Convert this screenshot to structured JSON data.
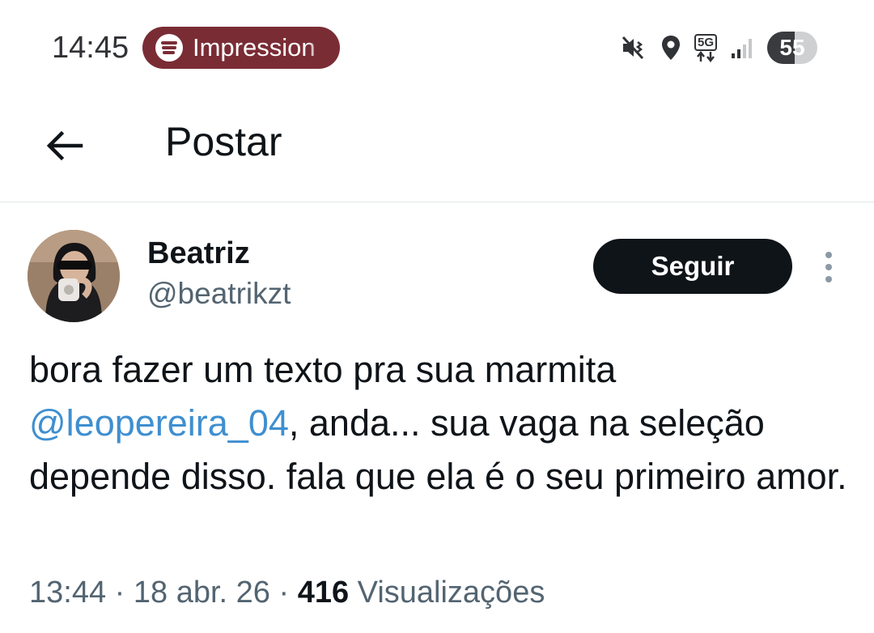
{
  "status_bar": {
    "time": "14:45",
    "media_pill": {
      "app_icon": "spotify-icon",
      "label": "Impression",
      "color": "#7a2c35"
    },
    "network_label": "5G",
    "battery_level": "55",
    "battery_fraction": 0.55,
    "icons": [
      "mute-vibrate-icon",
      "location-icon",
      "5g-data-icon",
      "signal-icon",
      "battery-icon"
    ]
  },
  "header": {
    "back_icon": "arrow-left-icon",
    "title": "Postar"
  },
  "post": {
    "author_name": "Beatriz",
    "author_handle": "@beatrikzt",
    "follow_label": "Seguir",
    "text_before_mention": "bora fazer um texto pra sua marmita ",
    "mention": "@leopereira_04",
    "text_after_mention": ", anda... sua vaga na seleção depende disso. fala que ela é o seu primeiro amor.",
    "time": "13:44",
    "date": "18 abr. 26",
    "separator": "·",
    "views_count": "416",
    "views_label": "Visualizações"
  },
  "colors": {
    "text": "#0f1419",
    "muted": "#536471",
    "link": "#3f8fd0",
    "button": "#0f1419"
  }
}
